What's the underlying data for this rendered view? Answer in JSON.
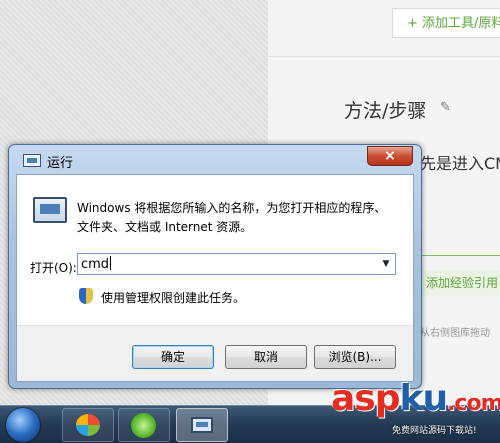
{
  "webpage": {
    "add_tools": "+ 添加工具/原料",
    "method_title": "方法/步骤",
    "step_text": "先是进入CM",
    "add_experience": "添加经验引用",
    "small_note": "从右侧图库拖动"
  },
  "dialog": {
    "title": "运行",
    "close_glyph": "×",
    "description": "Windows 将根据您所输入的名称，为您打开相应的程序、文件夹、文档或 Internet 资源。",
    "open_label": "打开(O):",
    "open_value": "cmd",
    "admin_note": "使用管理权限创建此任务。",
    "buttons": {
      "ok": "确定",
      "cancel": "取消",
      "browse": "浏览(B)..."
    }
  },
  "watermark": {
    "part1": "asp",
    "part2": "ku",
    "part3": ".com",
    "sub": "免费网站源码下载站!"
  }
}
